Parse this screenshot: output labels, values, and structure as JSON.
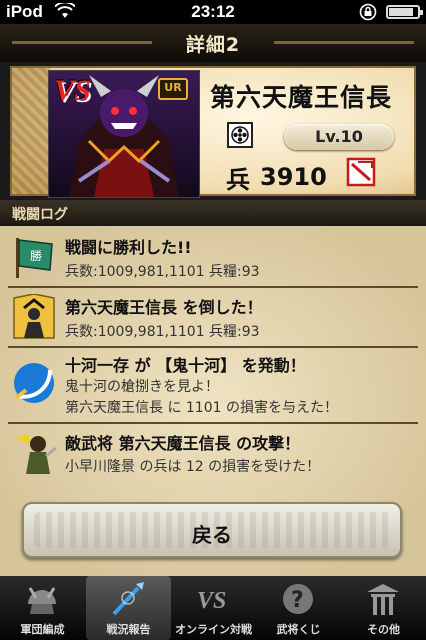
{
  "status_bar": {
    "carrier": "iPod",
    "time": "23:12",
    "battery_level": 0.85
  },
  "title_bar": {
    "title": "詳細2"
  },
  "opponent": {
    "vs_label": "VS",
    "rarity_badge": "UR",
    "name": "第六天魔王信長",
    "level": "Lv.10",
    "troop_icon_char": "兵",
    "troop_count": "3910"
  },
  "battle_log": {
    "header": "戦闘ログ",
    "entries": [
      {
        "icon": "victory-flag-icon",
        "line1": "戦闘に勝利した!!",
        "line2": "兵数:1009,981,1101 兵糧:93"
      },
      {
        "icon": "defeated-general-icon",
        "line1": "第六天魔王信長 を倒した！",
        "line2": "兵数:1009,981,1101 兵糧:93"
      },
      {
        "icon": "skill-slash-icon",
        "line1": "十河一存 が 【鬼十河】 を発動！",
        "line2": "鬼十河の槍捌きを見よ！",
        "line3": "第六天魔王信長 に 1101 の損害を与えた！"
      },
      {
        "icon": "enemy-attack-icon",
        "line1": "敵武将 第六天魔王信長 の攻撃！",
        "line2": "小早川隆景 の兵は 12 の損害を受けた！"
      }
    ]
  },
  "back_button": {
    "label": "戻る"
  },
  "tab_bar": {
    "tabs": [
      {
        "label": "軍団編成",
        "icon": "helmet-icon",
        "active": false
      },
      {
        "label": "戦況報告",
        "icon": "spear-icon",
        "active": true
      },
      {
        "label": "オンライン対戦",
        "icon": "vs-icon",
        "active": false
      },
      {
        "label": "武将くじ",
        "icon": "question-icon",
        "active": false
      },
      {
        "label": "その他",
        "icon": "shrine-icon",
        "active": false
      }
    ]
  }
}
